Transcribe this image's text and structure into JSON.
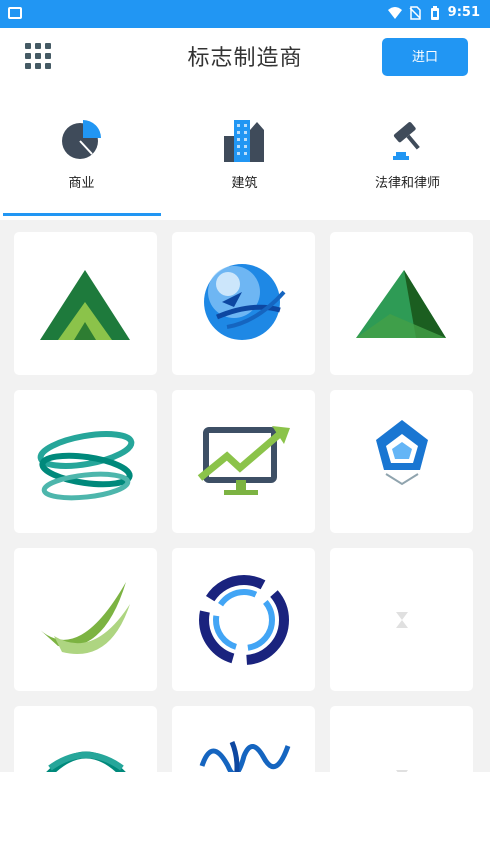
{
  "status_bar": {
    "time": "9:51"
  },
  "app_bar": {
    "title": "标志制造商",
    "import_label": "进口"
  },
  "tabs": [
    {
      "label": "商业",
      "icon": "pie-chart-icon",
      "selected": true
    },
    {
      "label": "建筑",
      "icon": "buildings-icon",
      "selected": false
    },
    {
      "label": "法律和律师",
      "icon": "gavel-icon",
      "selected": false
    }
  ],
  "colors": {
    "accent": "#2196f3",
    "background": "#f2f2f2"
  },
  "logos": [
    {
      "icon": "green-mountain-logo",
      "loaded": true
    },
    {
      "icon": "blue-globe-arrows-logo",
      "loaded": true
    },
    {
      "icon": "green-pyramid-logo",
      "loaded": true
    },
    {
      "icon": "teal-swirl-logo",
      "loaded": true
    },
    {
      "icon": "monitor-growth-arrow-logo",
      "loaded": true
    },
    {
      "icon": "blue-pentagon-logo",
      "loaded": true
    },
    {
      "icon": "green-swoosh-logo",
      "loaded": true
    },
    {
      "icon": "blue-circle-swirl-logo",
      "loaded": true
    },
    {
      "icon": "loading-placeholder-icon",
      "loaded": false
    },
    {
      "icon": "teal-globe-stripes-logo",
      "loaded": true
    },
    {
      "icon": "blue-script-logo",
      "loaded": true
    },
    {
      "icon": "loading-placeholder-icon",
      "loaded": false
    }
  ]
}
